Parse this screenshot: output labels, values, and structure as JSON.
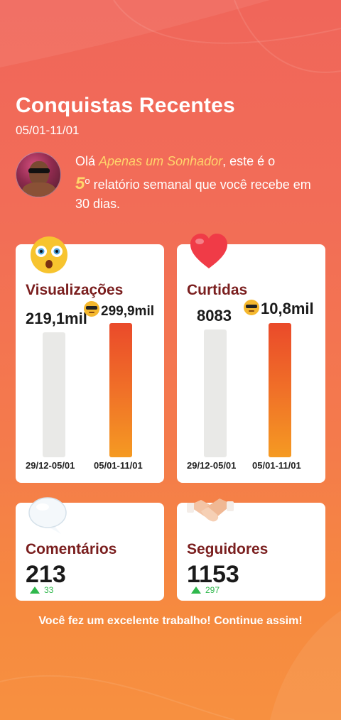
{
  "header": {
    "title": "Conquistas Recentes",
    "date_range": "05/01-11/01"
  },
  "greeting": {
    "prefix": "Olá ",
    "name": "Apenas um Sonhador",
    "mid": ", este é o ",
    "ordinal_num": "5",
    "ordinal_suffix": "o",
    "suffix": " relatório semanal que você recebe em 30 dias."
  },
  "cards": {
    "views": {
      "label": "Visualizações",
      "previous_value": "219,1mil",
      "current_value": "299,9mil",
      "previous_period": "29/12-05/01",
      "current_period": "05/01-11/01",
      "emoji": "surprised-face-icon"
    },
    "likes": {
      "label": "Curtidas",
      "previous_value": "8083",
      "current_value": "10,8mil",
      "previous_period": "29/12-05/01",
      "current_period": "05/01-11/01",
      "emoji": "heart-icon"
    },
    "comments": {
      "label": "Comentários",
      "value": "213",
      "delta": "33",
      "emoji": "speech-bubble-icon"
    },
    "followers": {
      "label": "Seguidores",
      "value": "1153",
      "delta": "297",
      "emoji": "handshake-icon"
    }
  },
  "footer": {
    "message": "Você fez um excelente trabalho! Continue assim!"
  },
  "colors": {
    "accent_name": "#ffd46b",
    "label_dark_red": "#7a1e1e",
    "delta_green": "#2fb84c",
    "bar_orange": "#f07028",
    "bar_grey": "#e9e9e7"
  }
}
